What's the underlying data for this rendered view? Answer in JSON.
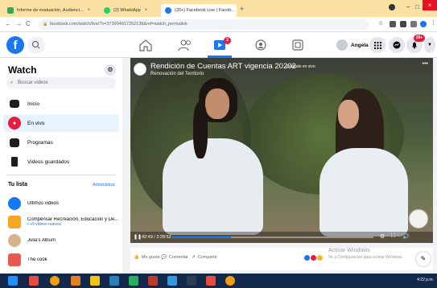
{
  "browser": {
    "tabs": [
      {
        "title": "Informe de evaluación, Audienci...",
        "close": "×",
        "color": "#34a853"
      },
      {
        "title": "(2) WhatsApp",
        "close": "×",
        "color": "#25d366"
      },
      {
        "title": "(20+) Facebook Live | Faceb...",
        "close": "×",
        "color": "#1877f2"
      }
    ],
    "new_tab": "+",
    "url": "facebook.com/watch/live/?v=373994817252138&ref=watch_permalink",
    "window_controls": {
      "minimize": "–",
      "maximize": "□",
      "close": "×"
    }
  },
  "fbnav": {
    "notification_badge": "2",
    "profile_name": "Angela",
    "alerts_badge": "20+"
  },
  "sidebar": {
    "title": "Watch",
    "search_placeholder": "Buscar videos",
    "items": [
      {
        "label": "Inicio",
        "color": "#1c1e21",
        "icon": "tv-icon"
      },
      {
        "label": "En vivo",
        "color": "#e41e3f",
        "icon": "live-icon"
      },
      {
        "label": "Programas",
        "color": "#1c1e21",
        "icon": "clapper-icon"
      },
      {
        "label": "Videos guardados",
        "color": "#1c1e21",
        "icon": "bookmark-icon"
      }
    ],
    "your_list_title": "Tu lista",
    "admin_label": "Administrar",
    "list_items": [
      {
        "label": "Últimos videos",
        "sub": "",
        "color": "#1877f2"
      },
      {
        "label": "Compensar Recreación, Educación y De...",
        "sub": "• +9 videos nuevos",
        "color": "#f5a623"
      },
      {
        "label": "Julia's Album",
        "sub": "",
        "color": "#d6b38a"
      },
      {
        "label": "The cook",
        "sub": "",
        "color": "#e85a4f"
      }
    ]
  },
  "video": {
    "title": "Rendición de Cuentas ART vigencia 20202",
    "badge": "Grabado en vivo",
    "subtitle": "Renovación del Territorio",
    "more": "•••",
    "time": "42:49 / 2:28:52",
    "progress": 0.29
  },
  "actions": {
    "like": "Me gusta",
    "comment": "Comentar",
    "share": "Compartir",
    "watermark_title": "Activar Windows",
    "watermark_sub": "Ve a Configuración para activar Windows."
  },
  "taskbar": {
    "time": "4:22 p.m."
  }
}
